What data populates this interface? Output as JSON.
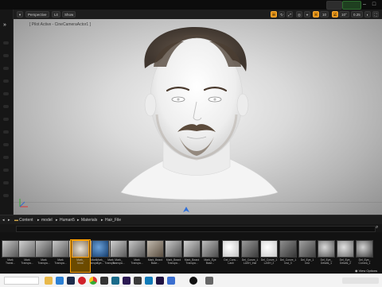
{
  "viewport": {
    "perspective_label": "Perspective",
    "lit_label": "Lit",
    "show_label": "Show",
    "pilot_label": "[ Pilot Active - CineCameraActor1 ]",
    "snap_value": "10",
    "rotation_value": "10°",
    "scale_value": "0.25"
  },
  "content_browser": {
    "breadcrumb": [
      "Content",
      "model",
      "Human5",
      "Materials",
      "Hair_File"
    ],
    "view_options_label": "View Options",
    "assets": [
      {
        "label": "Mark\nTransl..."
      },
      {
        "label": "Mark\nTranspa..."
      },
      {
        "label": "Mark\nTranspa..."
      },
      {
        "label": "Mark\nTranspa..."
      },
      {
        "label": "Mark\nTranspa..."
      },
      {
        "label": "Mark\nTranspa..."
      },
      {
        "label": "Mark\nTranspa..."
      },
      {
        "label": "Mark_\nbrow",
        "selected": true
      },
      {
        "label": "Mark_\nEye..."
      },
      {
        "label": "Mark_\nTranspa..."
      },
      {
        "label": "Mark\nTranspa..."
      },
      {
        "label": "Mark_Beard\nBase..."
      },
      {
        "label": "Mark_Beard\nTranspa..."
      },
      {
        "label": "Mark_Beard\nTranspa..."
      },
      {
        "label": "Mark_Eye\nBase..."
      },
      {
        "label": "Del_Conv...\nLash"
      },
      {
        "label": "Del_Conve_1\nLASH_Inst"
      },
      {
        "label": "Del_Conve_1\nLASH_2"
      },
      {
        "label": "Del_Conve_1\nInst_3"
      },
      {
        "label": "Del_Eye_1\nInst"
      },
      {
        "label": "Del_Eye_\nDetails_1"
      },
      {
        "label": "Del_Eye_\nDetails_2"
      },
      {
        "label": "Del_Eye_\nCornea_1"
      }
    ]
  },
  "taskbar": {
    "search_placeholder": ""
  }
}
